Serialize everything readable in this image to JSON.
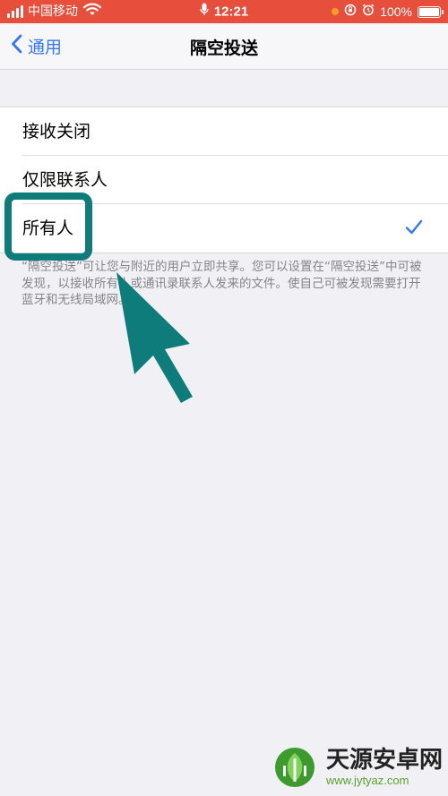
{
  "status_bar": {
    "carrier": "中国移动",
    "time": "12:21",
    "battery": "100%",
    "icons": [
      "signal-icon",
      "wifi-icon",
      "mic-icon",
      "orientation-lock-icon",
      "alarm-icon",
      "battery-icon"
    ],
    "background_color": "#e74e3b"
  },
  "nav": {
    "back_label": "通用",
    "title": "隔空投送"
  },
  "options": [
    {
      "label": "接收关闭",
      "selected": false
    },
    {
      "label": "仅限联系人",
      "selected": false
    },
    {
      "label": "所有人",
      "selected": true
    }
  ],
  "footer": "“隔空投送”可让您与附近的用户立即共享。您可以设置在“隔空投送”中可被发现，以接收所有人或通讯录联系人发来的文件。使自己可被发现需要打开蓝牙和无线局域网。",
  "annotation": {
    "highlight_color": "#0e7c7b",
    "highlighted_option": "所有人"
  },
  "watermark": {
    "brand": "天源安卓网",
    "url": "www.jytyaz.com"
  },
  "colors": {
    "accent": "#3478f6",
    "background": "#f1f1f5"
  }
}
